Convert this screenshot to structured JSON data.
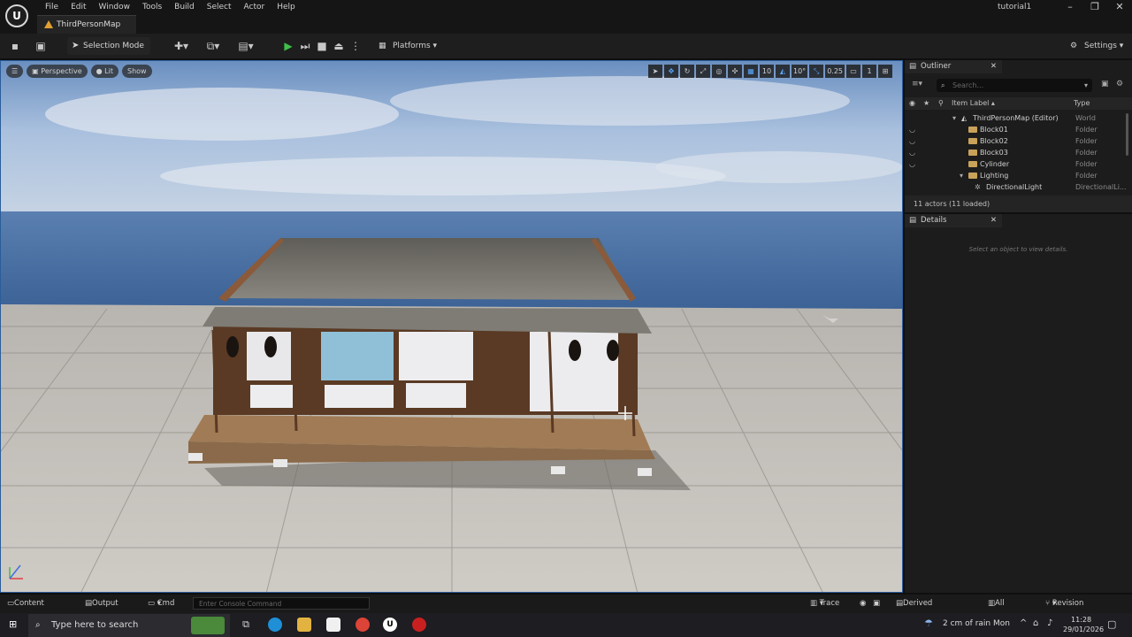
{
  "menu": [
    "File",
    "Edit",
    "Window",
    "Tools",
    "Build",
    "Select",
    "Actor",
    "Help"
  ],
  "map_tab": "ThirdPersonMap",
  "project_name": "tutorial1",
  "toolbar": {
    "selection_mode": "Selection Mode",
    "platforms": "Platforms",
    "settings": "Settings"
  },
  "viewport": {
    "perspective": "Perspective",
    "lit": "Lit",
    "show": "Show",
    "grid_snap": "10",
    "rotation_snap": "10°",
    "scale_snap": "0.25",
    "camera_speed": "1"
  },
  "outliner": {
    "tab": "Outliner",
    "search_placeholder": "Search...",
    "col_label": "Item Label ▴",
    "col_type": "Type",
    "rows": [
      {
        "label": "ThirdPersonMap (Editor)",
        "type": "World"
      },
      {
        "label": "Block01",
        "type": "Folder"
      },
      {
        "label": "Block02",
        "type": "Folder"
      },
      {
        "label": "Block03",
        "type": "Folder"
      },
      {
        "label": "Cylinder",
        "type": "Folder"
      },
      {
        "label": "Lighting",
        "type": "Folder"
      },
      {
        "label": "DirectionalLight",
        "type": "DirectionalLi..."
      }
    ],
    "footer": "11 actors (11 loaded)"
  },
  "details": {
    "tab": "Details",
    "empty": "Select an object to view details."
  },
  "statusbar": {
    "content_drawer": "Content Drawer",
    "output_log": "Output Log",
    "cmd": "Cmd",
    "console_placeholder": "Enter Console Command",
    "trace": "Trace",
    "derived_data": "Derived Data",
    "all_saved": "All Saved",
    "revision_control": "Revision Control"
  },
  "taskbar": {
    "search_placeholder": "Type here to search",
    "weather": "2 cm of rain Mon",
    "time": "11:28",
    "date": "29/01/2026"
  },
  "colors": {
    "accent": "#2a7ad5",
    "play": "#3fbf4a",
    "folder": "#c9a25a"
  }
}
